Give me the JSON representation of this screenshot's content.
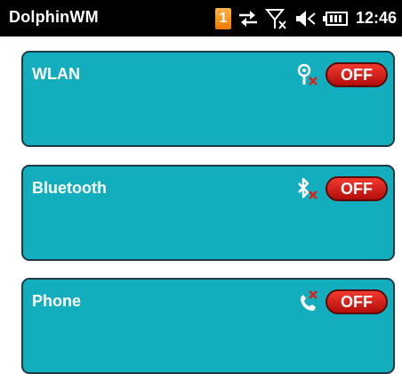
{
  "titlebar": {
    "app_title": "DolphinWM",
    "notification_count": "1",
    "time": "12:46",
    "icons": [
      "notification-badge",
      "sync-arrows-icon",
      "no-signal-icon",
      "speaker-off-icon",
      "battery-icon"
    ]
  },
  "panels": [
    {
      "label": "WLAN",
      "icon": "wifi-disabled-icon",
      "toggle": "OFF"
    },
    {
      "label": "Bluetooth",
      "icon": "bluetooth-disabled-icon",
      "toggle": "OFF"
    },
    {
      "label": "Phone",
      "icon": "phone-disabled-icon",
      "toggle": "OFF"
    }
  ],
  "colors": {
    "panel": "#12aebe",
    "panel_border": "#1f3a44",
    "toggle_off": "#d8231a",
    "titlebar": "#000000"
  }
}
